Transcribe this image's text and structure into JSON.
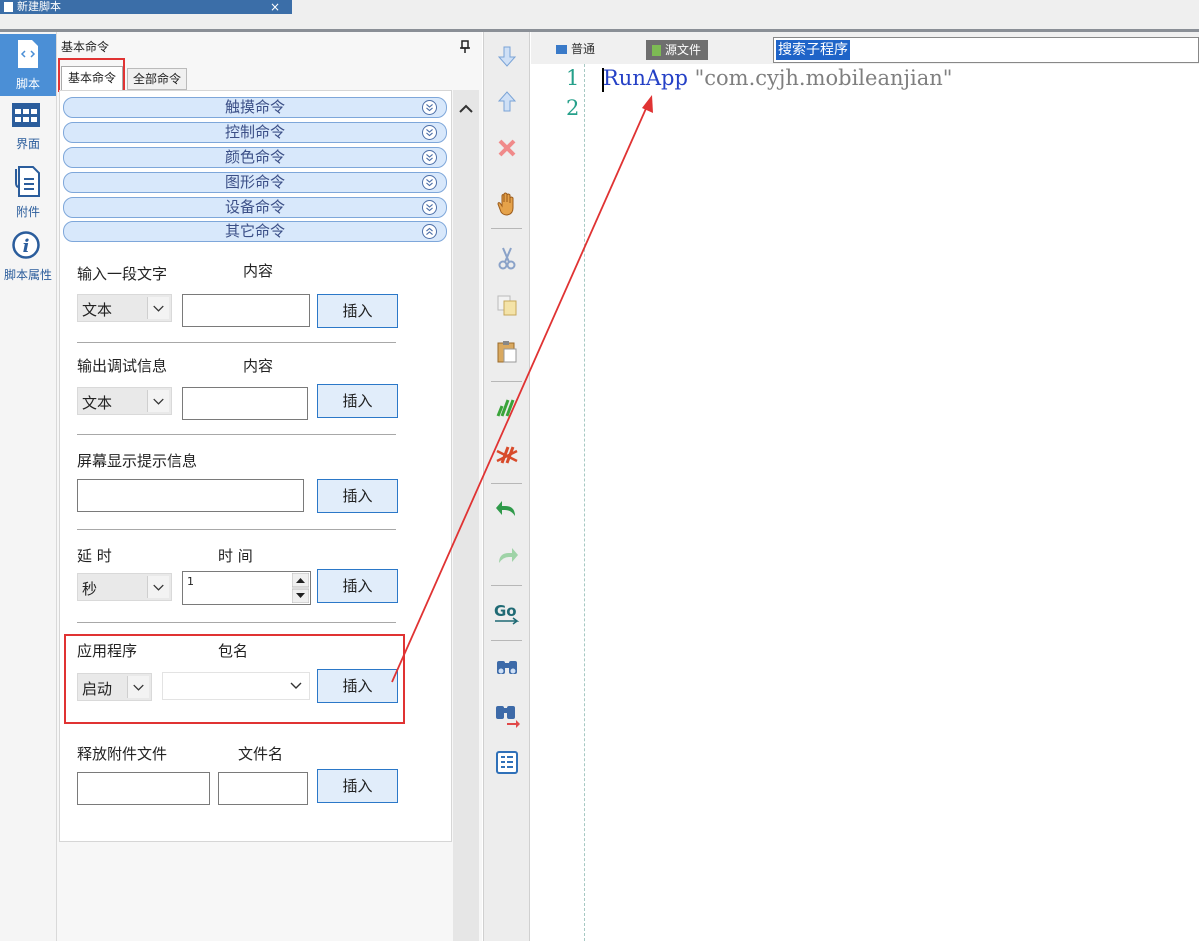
{
  "window": {
    "doc_tab_title": "新建脚本",
    "close_glyph": "×"
  },
  "nav": {
    "items": [
      {
        "label": "脚本",
        "icon": "script-icon",
        "active": true
      },
      {
        "label": "界面",
        "icon": "grid-icon"
      },
      {
        "label": "附件",
        "icon": "attachment-icon"
      },
      {
        "label": "脚本属性",
        "icon": "info-icon"
      }
    ]
  },
  "panel": {
    "title": "基本命令",
    "tabs": {
      "basic": "基本命令",
      "all": "全部命令"
    },
    "categories": [
      "触摸命令",
      "控制命令",
      "颜色命令",
      "图形命令",
      "设备命令",
      "其它命令"
    ]
  },
  "forms": {
    "input_text": {
      "label": "输入一段文字",
      "content_label": "内容",
      "select_value": "文本",
      "insert": "插入"
    },
    "debug_output": {
      "label": "输出调试信息",
      "content_label": "内容",
      "select_value": "文本",
      "insert": "插入"
    },
    "screen_tip": {
      "label": "屏幕显示提示信息",
      "insert": "插入"
    },
    "delay": {
      "label": "延 时",
      "time_label": "时 间",
      "select_value": "秒",
      "spinner_value": "1",
      "insert": "插入"
    },
    "app": {
      "label": "应用程序",
      "package_label": "包名",
      "select_value": "启动",
      "package_value": "",
      "insert": "插入"
    },
    "release_file": {
      "label": "释放附件文件",
      "filename_label": "文件名",
      "insert": "插入"
    }
  },
  "toolbar": {
    "icons": [
      "move-down-icon",
      "move-up-icon",
      "delete-icon",
      "hand-icon",
      "cut-icon",
      "copy-icon",
      "paste-icon",
      "comment-icon",
      "uncomment-icon",
      "undo-icon",
      "redo-icon",
      "goto-icon",
      "find-icon",
      "find-next-icon",
      "outline-icon"
    ]
  },
  "editor": {
    "mode_normal": "普通",
    "mode_source": "源文件",
    "search_selected": "搜索子程序",
    "line_numbers": [
      "1",
      "2"
    ],
    "code_keyword": "RunApp",
    "code_string": " \"com.cyjh.mobileanjian\""
  },
  "colors": {
    "accent": "#4b8fd6",
    "highlight": "#e03333",
    "keyword": "#2440c6",
    "string": "#7f7f7f",
    "line_number": "#25a08a"
  }
}
